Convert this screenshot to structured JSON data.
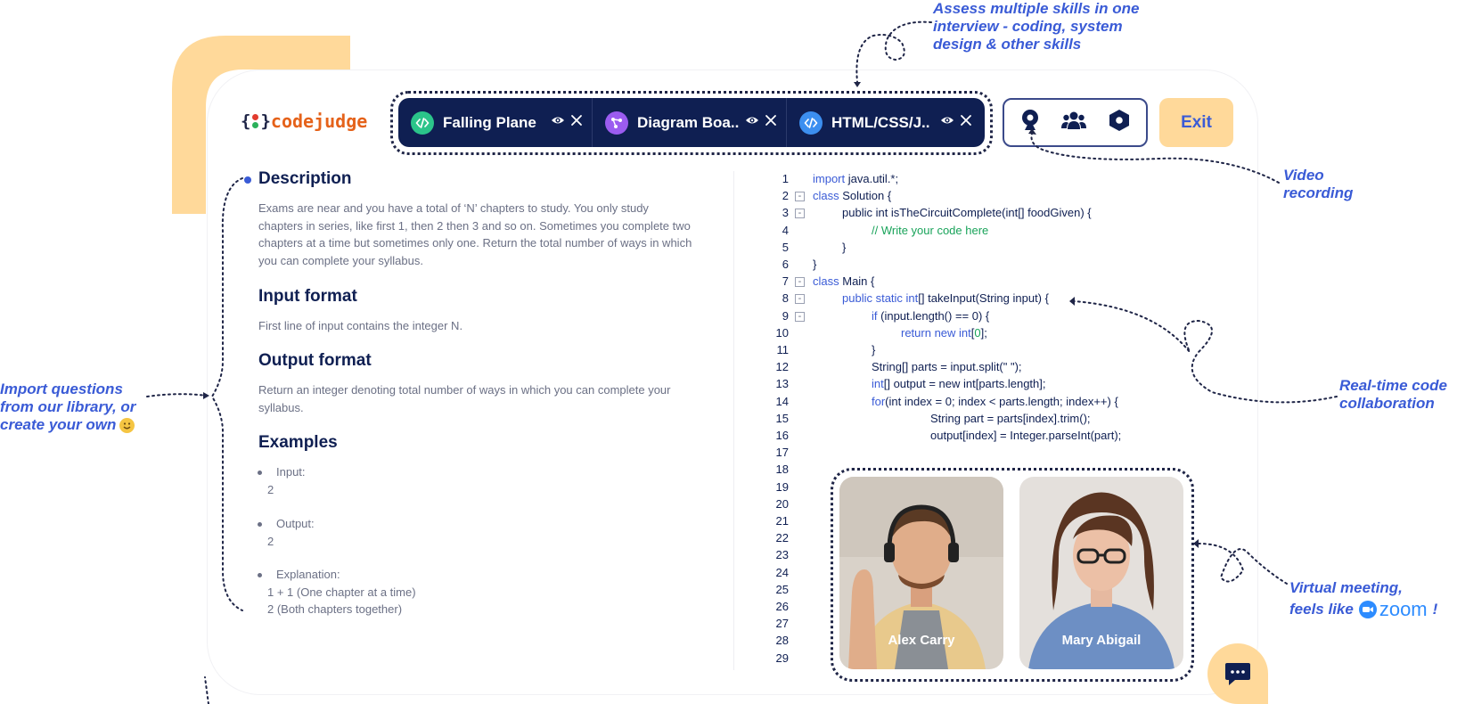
{
  "brand": {
    "name": "codejudge",
    "brace_left": "{",
    "brace_right": "}"
  },
  "tabs": [
    {
      "label": "Falling Plane",
      "icon": "code-icon",
      "color": "#2bc48a"
    },
    {
      "label": "Diagram Boa..",
      "icon": "diagram-icon",
      "color": "#9b5cf0"
    },
    {
      "label": "HTML/CSS/J..",
      "icon": "code-icon",
      "color": "#3c8ff0"
    }
  ],
  "tools": [
    "webcam-icon",
    "participants-icon",
    "settings-icon"
  ],
  "exit_label": "Exit",
  "problem": {
    "title": "Description",
    "description": "Exams are near and you have a total of ‘N’ chapters to study. You only study chapters in series, like first 1, then 2 then 3 and so on. Sometimes you complete two chapters at a time but sometimes only one. Return the total number of ways in which you can complete your syllabus.",
    "input_title": "Input format",
    "input_text": "First line of input contains the integer N.",
    "output_title": "Output format",
    "output_text": "Return an integer denoting total number of ways in which you can complete your syllabus.",
    "examples_title": "Examples",
    "examples": [
      {
        "label": "Input:",
        "lines": [
          "2"
        ]
      },
      {
        "label": "Output:",
        "lines": [
          "2"
        ]
      },
      {
        "label": "Explanation:",
        "lines": [
          "1 + 1 (One chapter at a time)",
          "2 (Both chapters together)"
        ]
      }
    ]
  },
  "code": {
    "line_count": 29,
    "folded_lines": [
      2,
      3,
      7,
      8,
      9
    ],
    "lines": [
      {
        "indent": 0,
        "parts": [
          [
            "kw",
            "import "
          ],
          [
            "",
            "java.util.*;"
          ]
        ]
      },
      {
        "indent": 0,
        "parts": [
          [
            "kw",
            "class "
          ],
          [
            "",
            "Solution {"
          ]
        ]
      },
      {
        "indent": 1,
        "parts": [
          [
            "",
            "public int isTheCircuitComplete(int[] foodGiven) {"
          ]
        ]
      },
      {
        "indent": 2,
        "parts": [
          [
            "cm",
            "// Write your code here"
          ]
        ]
      },
      {
        "indent": 1,
        "parts": [
          [
            "",
            "}"
          ]
        ]
      },
      {
        "indent": 0,
        "parts": [
          [
            "",
            "}"
          ]
        ]
      },
      {
        "indent": 0,
        "parts": [
          [
            "kw",
            "class "
          ],
          [
            "",
            "Main {"
          ]
        ]
      },
      {
        "indent": 1,
        "parts": [
          [
            "kw",
            "public static int"
          ],
          [
            "",
            "[] takeInput(String input) {"
          ]
        ]
      },
      {
        "indent": 2,
        "parts": [
          [
            "kw",
            "if "
          ],
          [
            "",
            "(input.length() == 0) {"
          ]
        ]
      },
      {
        "indent": 3,
        "parts": [
          [
            "kw",
            "return new int"
          ],
          [
            "",
            "["
          ],
          [
            "nm",
            "0"
          ],
          [
            "",
            "];"
          ]
        ]
      },
      {
        "indent": 2,
        "parts": [
          [
            "",
            "}"
          ]
        ]
      },
      {
        "indent": 2,
        "parts": [
          [
            "",
            "String[] parts = input.split(\" \");"
          ]
        ]
      },
      {
        "indent": 2,
        "parts": [
          [
            "kw",
            "int"
          ],
          [
            "",
            "[] output = new int[parts.length];"
          ]
        ]
      },
      {
        "indent": 2,
        "parts": [
          [
            "kw",
            "for"
          ],
          [
            "",
            "(int index = 0; index < parts.length; index++) {"
          ]
        ]
      },
      {
        "indent": 4,
        "parts": [
          [
            "",
            "String part = parts[index].trim();"
          ]
        ]
      },
      {
        "indent": 4,
        "parts": [
          [
            "",
            "output[index] = Integer.parseInt(part);"
          ]
        ]
      }
    ]
  },
  "participants": [
    {
      "name": "Alex Carry"
    },
    {
      "name": "Mary Abigail"
    }
  ],
  "annotations": {
    "skills": [
      "Assess multiple skills in one",
      "interview - coding, system",
      "design & other skills"
    ],
    "video": [
      "Video",
      "recording"
    ],
    "collab": [
      "Real-time code",
      "collaboration"
    ],
    "meeting_line1": "Virtual meeting,",
    "meeting_line2": "feels like",
    "meeting_brand": "zoom",
    "meeting_suffix": "!",
    "import_lines": [
      "Import questions",
      "from our library, or"
    ],
    "import_emph": "create your own"
  },
  "colors": {
    "navy": "#0f1f52",
    "accent": "#3a5bd6",
    "peach": "#ffd99a",
    "orange": "#e5621a"
  }
}
